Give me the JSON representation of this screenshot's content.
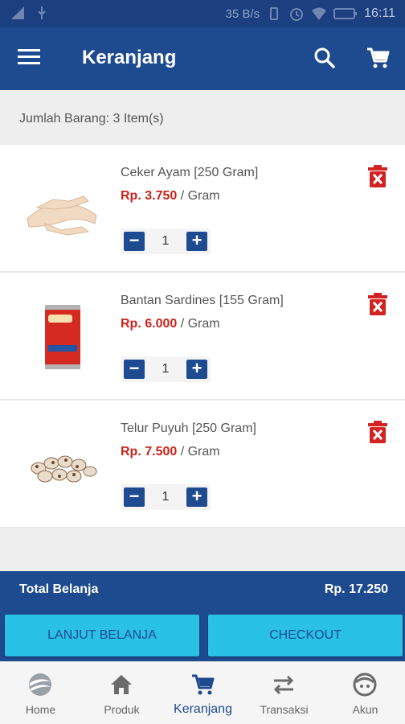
{
  "status_bar": {
    "speed": "35 B/s",
    "time": "16:11"
  },
  "app_bar": {
    "title": "Keranjang",
    "menu_icon": "hamburger-icon",
    "search_icon": "search-icon",
    "cart_icon": "cart-icon"
  },
  "summary": {
    "text": "Jumlah Barang: 3 Item(s)"
  },
  "items": [
    {
      "name": "Ceker Ayam [250 Gram]",
      "price": "Rp. 3.750",
      "unit": " / Gram",
      "qty": "1"
    },
    {
      "name": "Bantan Sardines [155 Gram]",
      "price": "Rp. 6.000",
      "unit": " / Gram",
      "qty": "1"
    },
    {
      "name": "Telur Puyuh [250 Gram]",
      "price": "Rp. 7.500",
      "unit": " / Gram",
      "qty": "1"
    }
  ],
  "total": {
    "label": "Total Belanja",
    "amount": "Rp. 17.250"
  },
  "actions": {
    "continue": "LANJUT BELANJA",
    "checkout": "CHECKOUT"
  },
  "nav": [
    {
      "label": "Home",
      "icon": "home-logo-icon"
    },
    {
      "label": "Produk",
      "icon": "house-icon"
    },
    {
      "label": "Keranjang",
      "icon": "cart-icon"
    },
    {
      "label": "Transaksi",
      "icon": "swap-arrows-icon"
    },
    {
      "label": "Akun",
      "icon": "face-icon"
    }
  ],
  "colors": {
    "primary": "#1e4a8f",
    "accent": "#29c1e6",
    "price": "#c8241c",
    "delete": "#d32222"
  }
}
